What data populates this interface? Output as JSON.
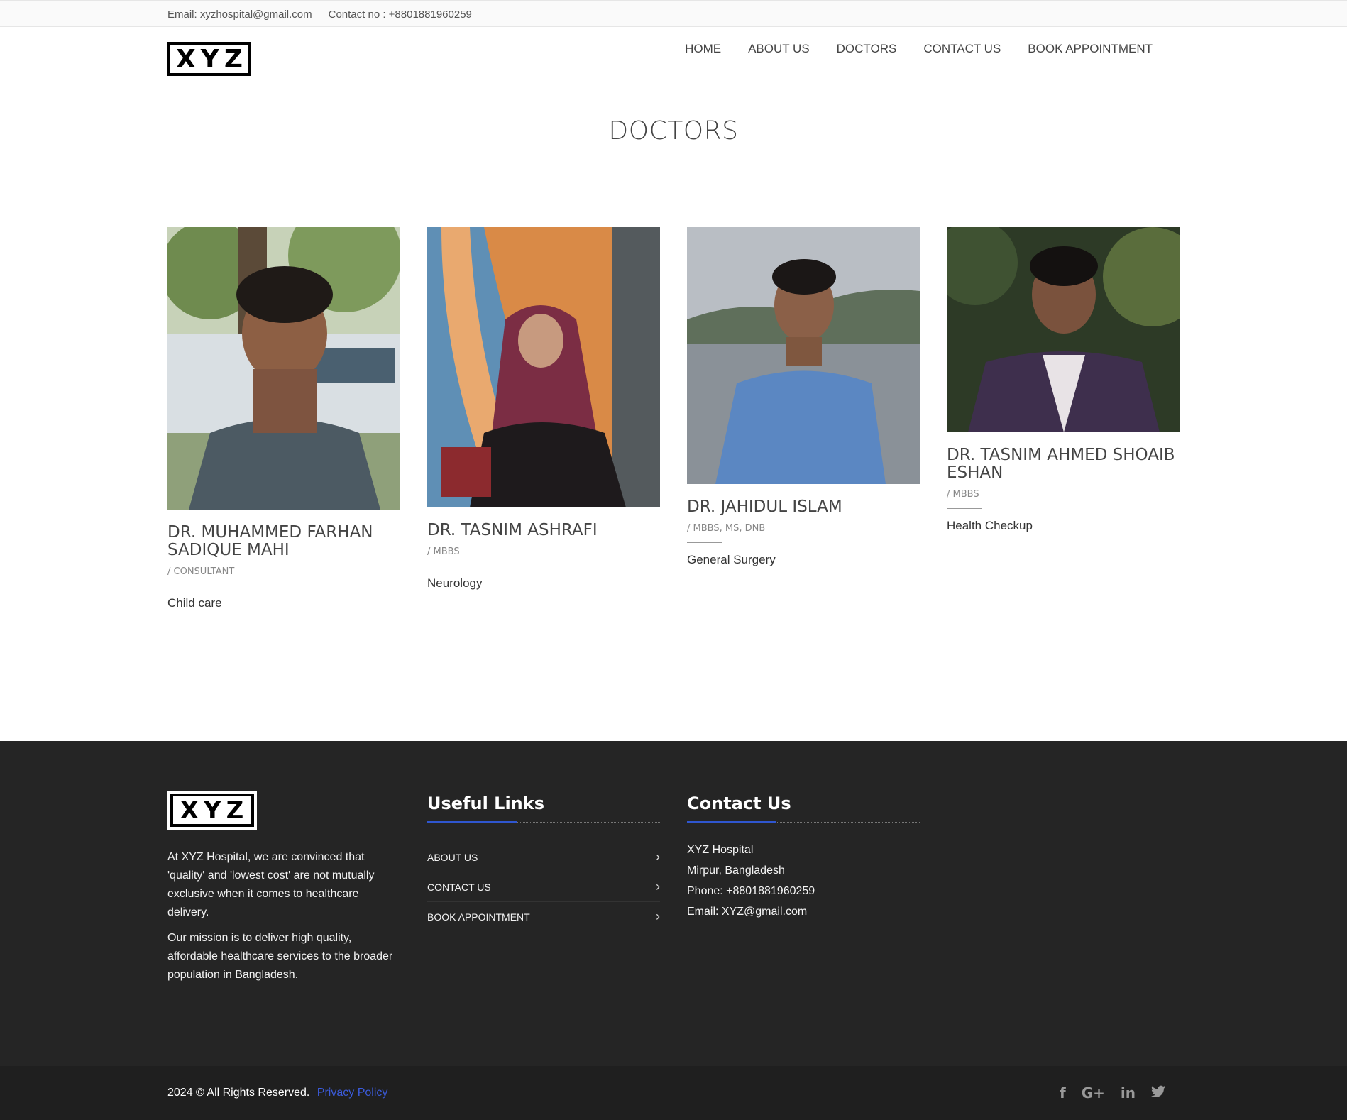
{
  "topbar": {
    "email": "Email: xyzhospital@gmail.com",
    "contact": "Contact no : +8801881960259"
  },
  "header": {
    "logo_text": "XYZ",
    "nav": [
      "HOME",
      "ABOUT US",
      "DOCTORS",
      "CONTACT US",
      "BOOK APPOINTMENT"
    ]
  },
  "page": {
    "title": "DOCTORS"
  },
  "doctors": [
    {
      "name": "DR. MUHAMMED FARHAN SADIQUE MAHI",
      "degree": "/ CONSULTANT",
      "specialty": "Child care"
    },
    {
      "name": "DR. TASNIM ASHRAFI",
      "degree": "/ MBBS",
      "specialty": "Neurology"
    },
    {
      "name": "DR. JAHIDUL ISLAM",
      "degree": "/ MBBS, MS, DNB",
      "specialty": "General Surgery"
    },
    {
      "name": "DR. TASNIM AHMED SHOAIB ESHAN",
      "degree": "/ MBBS",
      "specialty": "Health Checkup"
    }
  ],
  "footer": {
    "logo_text": "XYZ",
    "about_p1": "At XYZ Hospital, we are convinced that 'quality' and 'lowest cost' are not mutually exclusive when it comes to healthcare delivery.",
    "about_p2": "Our mission is to deliver high quality, affordable healthcare services to the broader population in Bangladesh.",
    "useful_links_title": "Useful Links",
    "useful_links": [
      "ABOUT US",
      "CONTACT US",
      "BOOK APPOINTMENT"
    ],
    "contact_title": "Contact Us",
    "contact_lines": [
      "XYZ Hospital",
      "Mirpur, Bangladesh",
      "Phone: +8801881960259",
      "Email: XYZ@gmail.com"
    ]
  },
  "bottombar": {
    "copyright": "2024 © All Rights Reserved.",
    "privacy": "Privacy Policy",
    "social_icons": [
      "facebook-icon",
      "google-plus-icon",
      "linkedin-icon",
      "twitter-icon"
    ]
  },
  "colors": {
    "accent": "#2f56d0",
    "footer_bg": "#252525",
    "bottom_bg": "#1f1f1f"
  }
}
